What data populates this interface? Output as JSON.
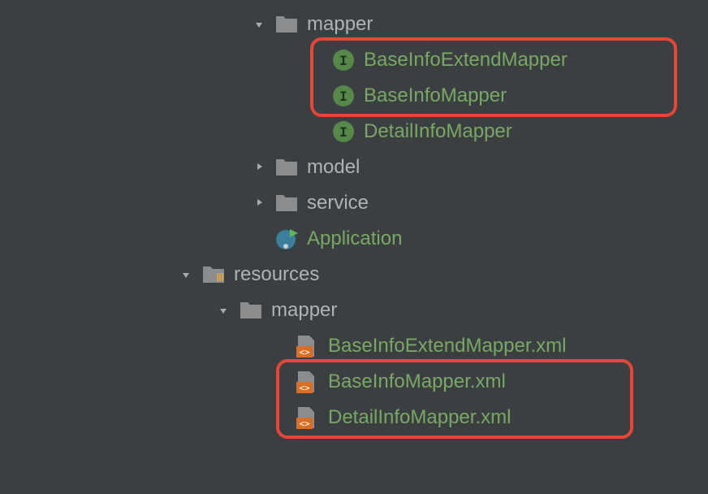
{
  "tree": {
    "mapper_folder": "mapper",
    "mapper_items": [
      "BaseInfoExtendMapper",
      "BaseInfoMapper",
      "DetailInfoMapper"
    ],
    "model_folder": "model",
    "service_folder": "service",
    "application_class": "Application",
    "resources_folder": "resources",
    "resources_mapper_folder": "mapper",
    "xml_items": [
      "BaseInfoExtendMapper.xml",
      "BaseInfoMapper.xml",
      "DetailInfoMapper.xml"
    ]
  },
  "colors": {
    "bg": "#3c3f41",
    "text": "#aeb3b7",
    "green": "#78a863",
    "highlight": "#e74536"
  }
}
